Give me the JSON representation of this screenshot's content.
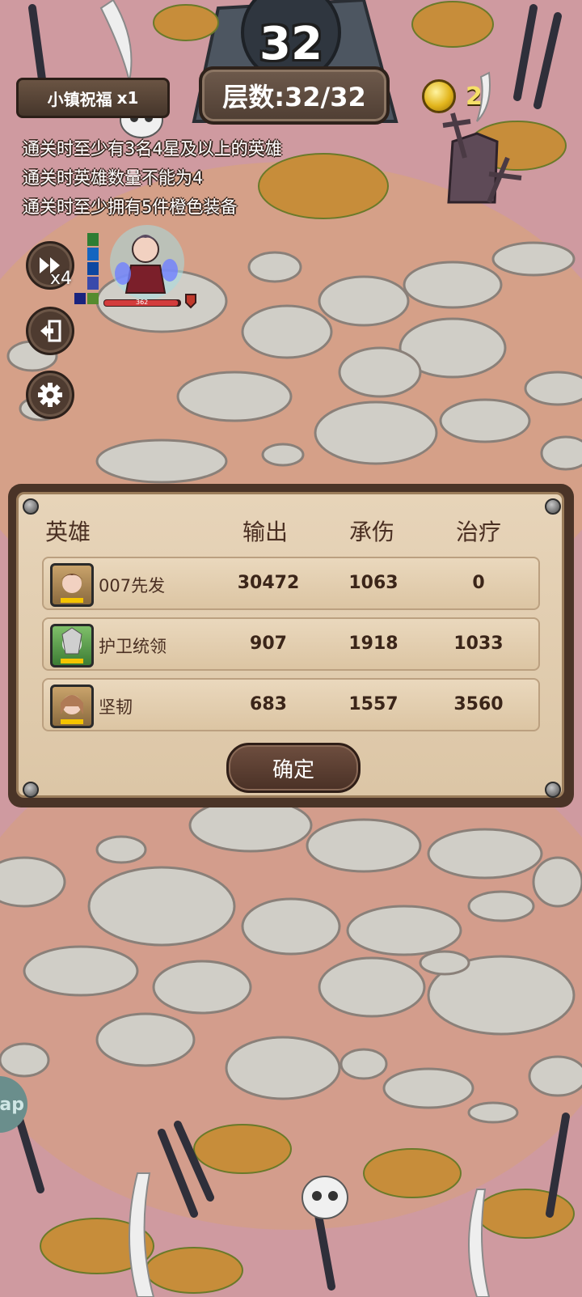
{
  "header": {
    "big_level": "32",
    "floor_label": "层数:32/32",
    "blessing_label": "小镇祝福",
    "blessing_count": "x1",
    "coin_count": "2"
  },
  "objectives": [
    "通关时至少有3名4星及以上的英雄",
    "通关时英雄数量不能为4",
    "通关时至少拥有5件橙色装备"
  ],
  "controls": {
    "speed_label": "x4",
    "fast_forward_icon": "fast-forward-icon",
    "exit_icon": "exit-icon",
    "settings_icon": "gear-icon"
  },
  "unit": {
    "hp_text": "362",
    "hp_fraction": 0.97
  },
  "stats_panel": {
    "headers": [
      "英雄",
      "输出",
      "承伤",
      "治疗"
    ],
    "rows": [
      {
        "name": "007先发",
        "output": "30472",
        "damage_taken": "1063",
        "healing": "0"
      },
      {
        "name": "护卫统领",
        "output": "907",
        "damage_taken": "1918",
        "healing": "1033"
      },
      {
        "name": "坚韧",
        "output": "683",
        "damage_taken": "1557",
        "healing": "3560"
      }
    ],
    "confirm_label": "确定"
  },
  "side_tab_label": "ap"
}
